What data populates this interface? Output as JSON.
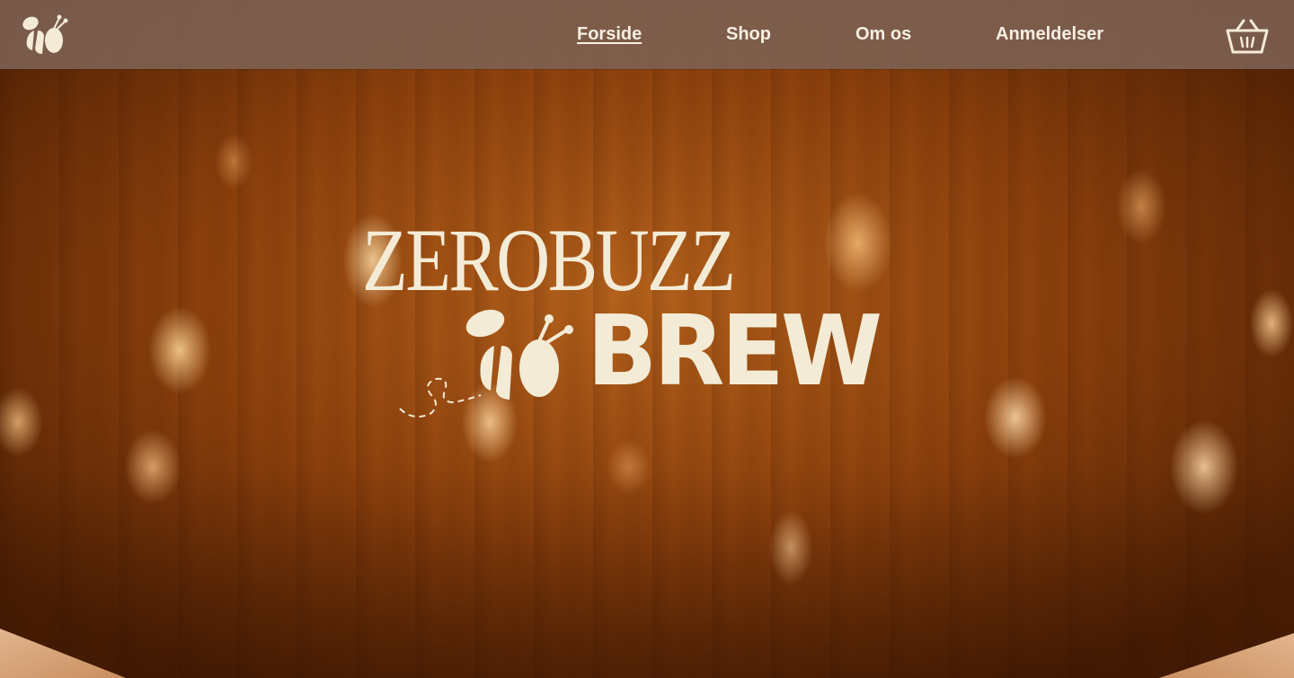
{
  "header": {
    "logo": "bee-logo",
    "nav": [
      {
        "label": "Forside",
        "active": true
      },
      {
        "label": "Shop",
        "active": false
      },
      {
        "label": "Om os",
        "active": false
      },
      {
        "label": "Anmeldelser",
        "active": false
      }
    ],
    "cart_icon": "basket-icon"
  },
  "hero": {
    "wordmark_top": "ZEROBUZZ",
    "wordmark_bottom": "BREW",
    "bee_icon": "bee-icon"
  },
  "colors": {
    "header_bg": "#7d5f50",
    "text_cream": "#f3ebd6",
    "hero_amber": "#b5621c"
  }
}
